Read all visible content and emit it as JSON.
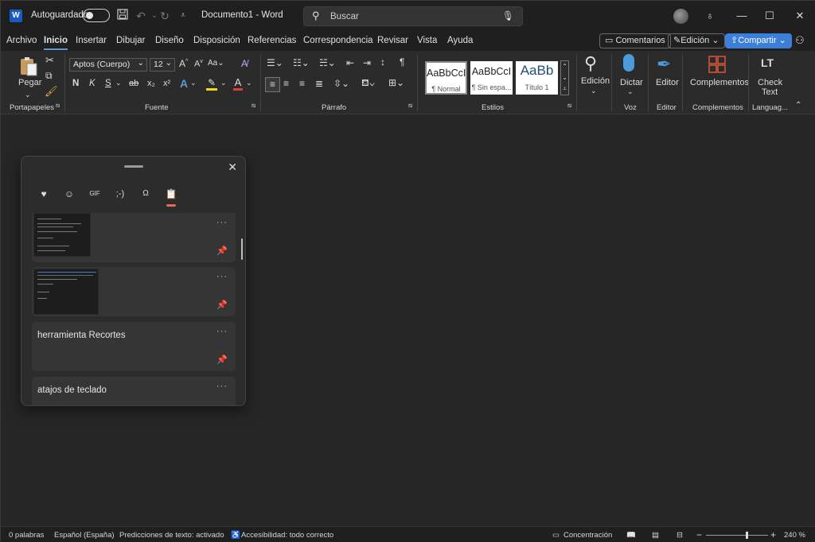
{
  "titlebar": {
    "app_badge": "W",
    "autosave_label": "Autoguardado",
    "autosave_state": "off",
    "doc_title": "Documento1  -  Word",
    "search_placeholder": "Buscar",
    "icons": [
      "save-icon",
      "undo-icon",
      "redo-icon",
      "customize-qat-icon",
      "lightbulb-icon",
      "minimize-icon",
      "maximize-icon",
      "close-icon"
    ]
  },
  "menu": {
    "tabs": [
      "Archivo",
      "Inicio",
      "Insertar",
      "Dibujar",
      "Diseño",
      "Disposición",
      "Referencias",
      "Correspondencia",
      "Revisar",
      "Vista",
      "Ayuda"
    ],
    "active_tab": "Inicio",
    "comments_label": "Comentarios",
    "editing_label": "Edición",
    "share_label": "Compartir"
  },
  "ribbon": {
    "clipboard": {
      "paste_label": "Pegar",
      "group": "Portapapeles"
    },
    "font": {
      "font_name": "Aptos (Cuerpo)",
      "font_size": "12",
      "bold": "N",
      "italic": "K",
      "underline": "S",
      "strike": "ab",
      "subscript": "x₂",
      "superscript": "x²",
      "group": "Fuente"
    },
    "paragraph": {
      "group": "Párrafo"
    },
    "styles": {
      "items": [
        {
          "sample": "AaBbCcI",
          "name": "¶ Normal"
        },
        {
          "sample": "AaBbCcI",
          "name": "¶ Sin espa..."
        },
        {
          "sample": "AaBb",
          "name": "Título 1"
        }
      ],
      "group": "Estilos"
    },
    "editing": {
      "label": "Edición"
    },
    "voice": {
      "label": "Dictar",
      "group": "Voz"
    },
    "editor": {
      "label": "Editor",
      "group": "Editor"
    },
    "addins": {
      "label": "Complementos",
      "group": "Complementos"
    },
    "checktext": {
      "label1": "Check",
      "label2": "Text",
      "group": "Languag..."
    }
  },
  "clipboard_panel": {
    "tabs": [
      "favorites-icon",
      "emoji-icon",
      "gif-icon",
      "kaomoji-icon",
      "symbols-icon",
      "clipboard-history-icon"
    ],
    "active_tab": "clipboard-history-icon",
    "items": [
      {
        "type": "image",
        "label": ""
      },
      {
        "type": "image",
        "label": ""
      },
      {
        "type": "text",
        "label": "herramienta Recortes"
      },
      {
        "type": "text",
        "label": "atajos de teclado"
      }
    ],
    "more_label": "···"
  },
  "statusbar": {
    "words": "0 palabras",
    "language": "Español (España)",
    "predictions": "Predicciones de texto: activado",
    "accessibility": "Accesibilidad: todo correcto",
    "focus": "Concentración",
    "zoom": "240 %"
  },
  "colors": {
    "accent": "#3c7fd9",
    "word_blue": "#185abd",
    "clip_active": "#e06c5a",
    "highlight": "#f5d90a",
    "font_red": "#e03c31"
  }
}
